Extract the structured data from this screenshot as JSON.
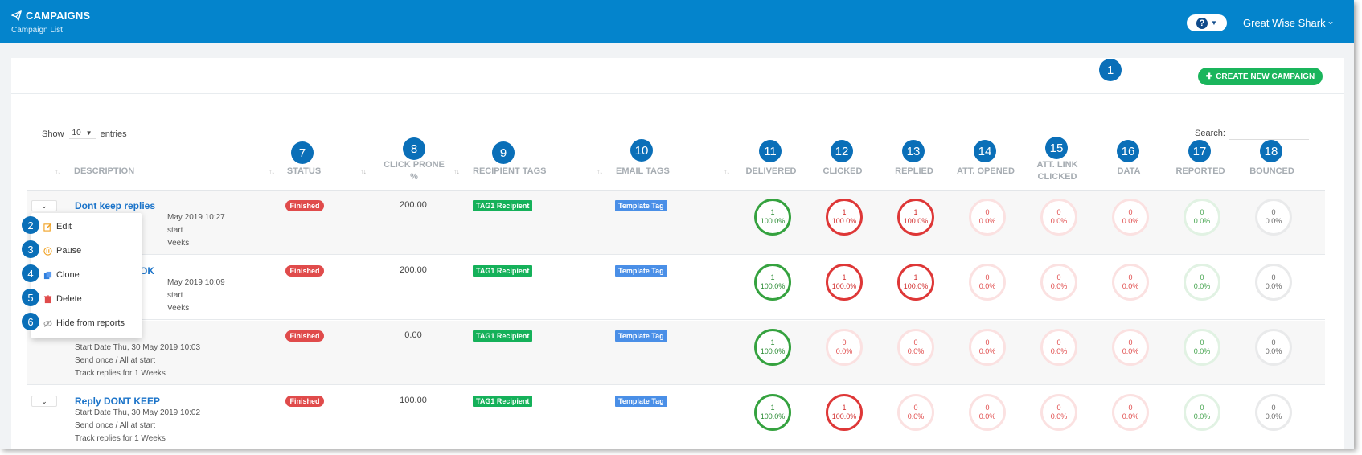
{
  "header": {
    "title": "CAMPAIGNS",
    "subtitle": "Campaign List",
    "help_icon": "question-icon",
    "user_name": "Great Wise Shark"
  },
  "toolbar": {
    "create_label": "CREATE NEW CAMPAIGN"
  },
  "table_controls": {
    "show_label": "Show",
    "entries_value": "10",
    "entries_label": "entries",
    "search_label": "Search:"
  },
  "callouts": [
    "1",
    "2",
    "3",
    "4",
    "5",
    "6",
    "7",
    "8",
    "9",
    "10",
    "11",
    "12",
    "13",
    "14",
    "15",
    "16",
    "17",
    "18"
  ],
  "columns": {
    "description": "DESCRIPTION",
    "status": "STATUS",
    "click_prone_1": "CLICK PRONE",
    "click_prone_2": "%",
    "recipient_tags": "RECIPIENT TAGS",
    "email_tags": "EMAIL TAGS",
    "delivered": "DELIVERED",
    "clicked": "CLICKED",
    "replied": "REPLIED",
    "att_opened": "ATT. OPENED",
    "att_link_1": "ATT. LINK",
    "att_link_2": "CLICKED",
    "data": "DATA",
    "reported": "REPORTED",
    "bounced": "BOUNCED"
  },
  "dropdown_menu": {
    "edit": "Edit",
    "pause": "Pause",
    "clone": "Clone",
    "delete": "Delete",
    "hide": "Hide from reports"
  },
  "rows": [
    {
      "name": "Dont keep replies",
      "line1": "May 2019 10:27",
      "line2": "start",
      "line3": "Veeks",
      "status": "Finished",
      "click_prone": "200.00",
      "recipient_tag": "TAG1 Recipient",
      "email_tag": "Template Tag",
      "stats": [
        {
          "count": "1",
          "pct": "100.0%"
        },
        {
          "count": "1",
          "pct": "100.0%"
        },
        {
          "count": "1",
          "pct": "100.0%"
        },
        {
          "count": "0",
          "pct": "0.0%"
        },
        {
          "count": "0",
          "pct": "0.0%"
        },
        {
          "count": "0",
          "pct": "0.0%"
        },
        {
          "count": "0",
          "pct": "0.0%"
        },
        {
          "count": "0",
          "pct": "0.0%"
        }
      ]
    },
    {
      "name": "OK",
      "line1": "May 2019 10:09",
      "line2": "start",
      "line3": "Veeks",
      "status": "Finished",
      "click_prone": "200.00",
      "recipient_tag": "TAG1 Recipient",
      "email_tag": "Template Tag",
      "stats": [
        {
          "count": "1",
          "pct": "100.0%"
        },
        {
          "count": "1",
          "pct": "100.0%"
        },
        {
          "count": "1",
          "pct": "100.0%"
        },
        {
          "count": "0",
          "pct": "0.0%"
        },
        {
          "count": "0",
          "pct": "0.0%"
        },
        {
          "count": "0",
          "pct": "0.0%"
        },
        {
          "count": "0",
          "pct": "0.0%"
        },
        {
          "count": "0",
          "pct": "0.0%"
        }
      ]
    },
    {
      "name": "",
      "line1": "Start Date Thu, 30 May 2019 10:03",
      "line2": "Send once / All at start",
      "line3": "Track replies for 1 Weeks",
      "status": "Finished",
      "click_prone": "0.00",
      "recipient_tag": "TAG1 Recipient",
      "email_tag": "Template Tag",
      "stats": [
        {
          "count": "1",
          "pct": "100.0%"
        },
        {
          "count": "0",
          "pct": "0.0%"
        },
        {
          "count": "0",
          "pct": "0.0%"
        },
        {
          "count": "0",
          "pct": "0.0%"
        },
        {
          "count": "0",
          "pct": "0.0%"
        },
        {
          "count": "0",
          "pct": "0.0%"
        },
        {
          "count": "0",
          "pct": "0.0%"
        },
        {
          "count": "0",
          "pct": "0.0%"
        }
      ]
    },
    {
      "name": "Reply DONT KEEP",
      "line1": "Start Date Thu, 30 May 2019 10:02",
      "line2": "Send once / All at start",
      "line3": "Track replies for 1 Weeks",
      "status": "Finished",
      "click_prone": "100.00",
      "recipient_tag": "TAG1 Recipient",
      "email_tag": "Template Tag",
      "stats": [
        {
          "count": "1",
          "pct": "100.0%"
        },
        {
          "count": "1",
          "pct": "100.0%"
        },
        {
          "count": "0",
          "pct": "0.0%"
        },
        {
          "count": "0",
          "pct": "0.0%"
        },
        {
          "count": "0",
          "pct": "0.0%"
        },
        {
          "count": "0",
          "pct": "0.0%"
        },
        {
          "count": "0",
          "pct": "0.0%"
        },
        {
          "count": "0",
          "pct": "0.0%"
        }
      ]
    }
  ],
  "colors": {
    "header_blue": "#0484cc",
    "callout_blue": "#0a6fb8",
    "create_green": "#1ab55c",
    "status_red": "#e04b4b",
    "recipient_tag_green": "#15b15a",
    "email_tag_blue": "#4a8fe7"
  }
}
